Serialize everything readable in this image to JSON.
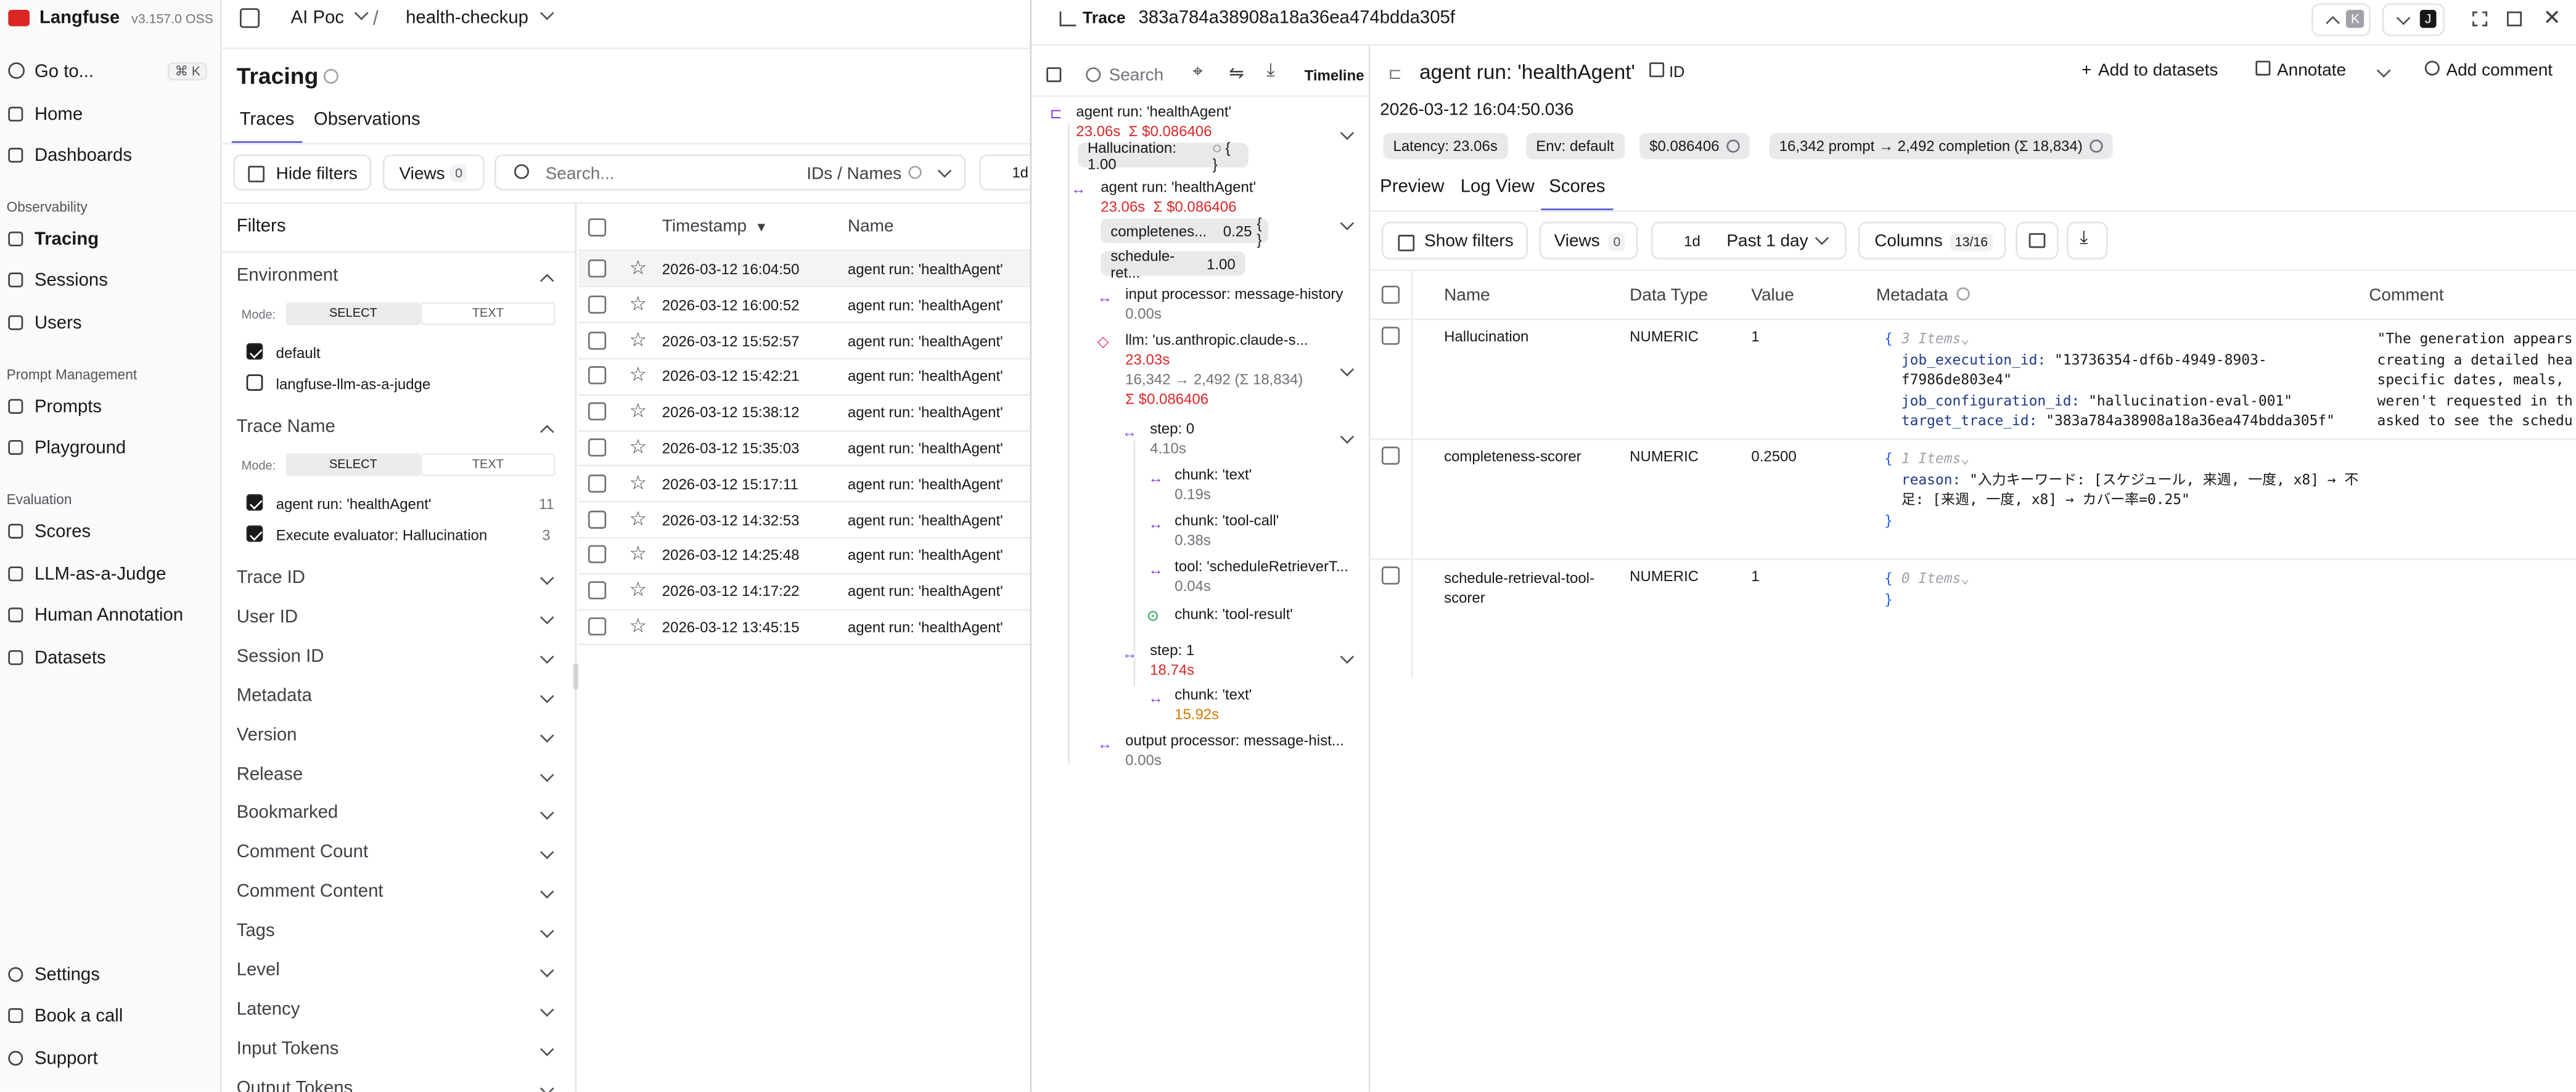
{
  "app": {
    "name": "Langfuse",
    "version": "v3.157.0 OSS",
    "org": "AI Poc",
    "project": "health-checkup"
  },
  "nav": {
    "goto": "Go to...",
    "goto_shortcut": "⌘ K",
    "home": "Home",
    "dashboards": "Dashboards",
    "section_observability": "Observability",
    "tracing": "Tracing",
    "sessions": "Sessions",
    "users": "Users",
    "section_prompt": "Prompt Management",
    "prompts": "Prompts",
    "playground": "Playground",
    "section_eval": "Evaluation",
    "scores": "Scores",
    "llm_judge": "LLM-as-a-Judge",
    "human_annotation": "Human Annotation",
    "datasets": "Datasets",
    "settings": "Settings",
    "book_call": "Book a call",
    "support": "Support"
  },
  "tracing": {
    "title": "Tracing",
    "tab_traces": "Traces",
    "tab_observations": "Observations",
    "hide_filters": "Hide filters",
    "views": "Views",
    "views_count": "0",
    "search_placeholder": "Search...",
    "ids_names": "IDs / Names",
    "range_short": "1d",
    "col_timestamp": "Timestamp",
    "col_name": "Name"
  },
  "filters": {
    "title": "Filters",
    "environment": "Environment",
    "mode": "Mode:",
    "select": "SELECT",
    "text": "TEXT",
    "env_default": "default",
    "env_judge": "langfuse-llm-as-a-judge",
    "trace_name": "Trace Name",
    "tn_agent": "agent run: 'healthAgent'",
    "tn_agent_count": "11",
    "tn_eval": "Execute evaluator: Hallucination",
    "tn_eval_count": "3",
    "collapsed": [
      "Trace ID",
      "User ID",
      "Session ID",
      "Metadata",
      "Version",
      "Release",
      "Bookmarked",
      "Comment Count",
      "Comment Content",
      "Tags",
      "Level",
      "Latency",
      "Input Tokens",
      "Output Tokens"
    ]
  },
  "traces": [
    {
      "ts": "2026-03-12 16:04:50",
      "name": "agent run: 'healthAgent'"
    },
    {
      "ts": "2026-03-12 16:00:52",
      "name": "agent run: 'healthAgent'"
    },
    {
      "ts": "2026-03-12 15:52:57",
      "name": "agent run: 'healthAgent'"
    },
    {
      "ts": "2026-03-12 15:42:21",
      "name": "agent run: 'healthAgent'"
    },
    {
      "ts": "2026-03-12 15:38:12",
      "name": "agent run: 'healthAgent'"
    },
    {
      "ts": "2026-03-12 15:35:03",
      "name": "agent run: 'healthAgent'"
    },
    {
      "ts": "2026-03-12 15:17:11",
      "name": "agent run: 'healthAgent'"
    },
    {
      "ts": "2026-03-12 14:32:53",
      "name": "agent run: 'healthAgent'"
    },
    {
      "ts": "2026-03-12 14:25:48",
      "name": "agent run: 'healthAgent'"
    },
    {
      "ts": "2026-03-12 14:17:22",
      "name": "agent run: 'healthAgent'"
    },
    {
      "ts": "2026-03-12 13:45:15",
      "name": "agent run: 'healthAgent'"
    }
  ],
  "trace_panel": {
    "label": "Trace",
    "id": "383a784a38908a18a36ea474bdda305f",
    "kbd_k": "K",
    "kbd_j": "J",
    "search": "Search",
    "timeline": "Timeline"
  },
  "tree": {
    "root_name": "agent run: 'healthAgent'",
    "root_time": "23.06s",
    "root_cost": "Σ $0.086406",
    "root_badge": "Hallucination: 1.00",
    "agent_name": "agent run: 'healthAgent'",
    "agent_time": "23.06s",
    "agent_cost": "Σ $0.086406",
    "badge_comp": "completenes...",
    "badge_comp_val": "0.25",
    "badge_sched": "schedule-ret...",
    "badge_sched_val": "1.00",
    "input_proc": "input processor: message-history",
    "input_proc_time": "0.00s",
    "llm_name": "llm: 'us.anthropic.claude-s...",
    "llm_time": "23.03s",
    "llm_tokens": "16,342 → 2,492 (Σ 18,834)",
    "llm_cost": "Σ $0.086406",
    "step0": "step: 0",
    "step0_time": "4.10s",
    "chunk_text": "chunk: 'text'",
    "chunk_text_time": "0.19s",
    "chunk_tool": "chunk: 'tool-call'",
    "chunk_tool_time": "0.38s",
    "tool": "tool: 'scheduleRetrieverT...",
    "tool_time": "0.04s",
    "chunk_result": "chunk: 'tool-result'",
    "step1": "step: 1",
    "step1_time": "18.74s",
    "chunk_text2": "chunk: 'text'",
    "chunk_text2_time": "15.92s",
    "output_proc": "output processor: message-hist...",
    "output_proc_time": "0.00s"
  },
  "detail": {
    "title": "agent run: 'healthAgent'",
    "id_label": "ID",
    "add_datasets": "Add to datasets",
    "annotate": "Annotate",
    "add_comment": "Add comment",
    "timestamp": "2026-03-12 16:04:50.036",
    "latency": "Latency: 23.06s",
    "env": "Env: default",
    "cost": "$0.086406",
    "tokens": "16,342 prompt → 2,492 completion (Σ 18,834)",
    "tab_preview": "Preview",
    "tab_log": "Log View",
    "tab_scores": "Scores",
    "show_filters": "Show filters",
    "views": "Views",
    "views_count": "0",
    "range_short": "1d",
    "range": "Past 1 day",
    "columns": "Columns",
    "columns_count": "13/16",
    "col_name": "Name",
    "col_type": "Data Type",
    "col_value": "Value",
    "col_meta": "Metadata",
    "col_comment": "Comment"
  },
  "scores": [
    {
      "name": "Hallucination",
      "type": "NUMERIC",
      "value": "1",
      "items": "3 Items",
      "k1": "job_execution_id:",
      "v1": "\"13736354-df6b-4949-8903-",
      "v1b": "f7986de803e4\"",
      "k2": "job_configuration_id:",
      "v2": "\"hallucination-eval-001\"",
      "k3": "target_trace_id:",
      "v3": "\"383a784a38908a18a36ea474bdda305f\"",
      "comment": [
        "\"The generation appears",
        "creating a detailed hea",
        "specific dates, meals,",
        "weren't requested in th",
        "asked to see the schedu"
      ]
    },
    {
      "name": "completeness-scorer",
      "type": "NUMERIC",
      "value": "0.2500",
      "items": "1 Items",
      "k1": "reason:",
      "v1": "\"入力キーワード: [スケジュール, 来週, 一度, x8] → 不",
      "v1b": "足: [来週, 一度, x8] → カバー率=0.25\""
    },
    {
      "name": "schedule-retrieval-tool-",
      "name2": "scorer",
      "type": "NUMERIC",
      "value": "1",
      "items": "0 Items"
    }
  ]
}
